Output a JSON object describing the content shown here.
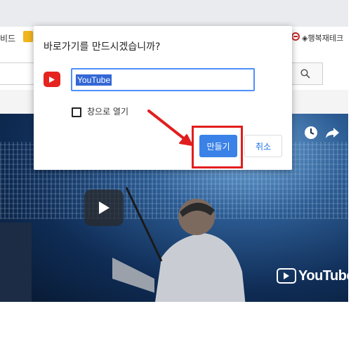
{
  "browser": {
    "bookmark_left_text": "비드",
    "bookmark_right_text": "◈행복재테크"
  },
  "video": {
    "watermark": "YouTube"
  },
  "dialog": {
    "title": "바로가기를 만드시겠습니까?",
    "name_value": "YouTube",
    "checkbox_label": "창으로 열기",
    "checkbox_checked": false,
    "create_label": "만들기",
    "cancel_label": "취소",
    "icon": "youtube-icon"
  },
  "annotation": {
    "highlight_color": "#e11e1e"
  },
  "colors": {
    "primary_button": "#3b82e8",
    "focus": "#4d90fe",
    "youtube_red": "#e52420"
  }
}
